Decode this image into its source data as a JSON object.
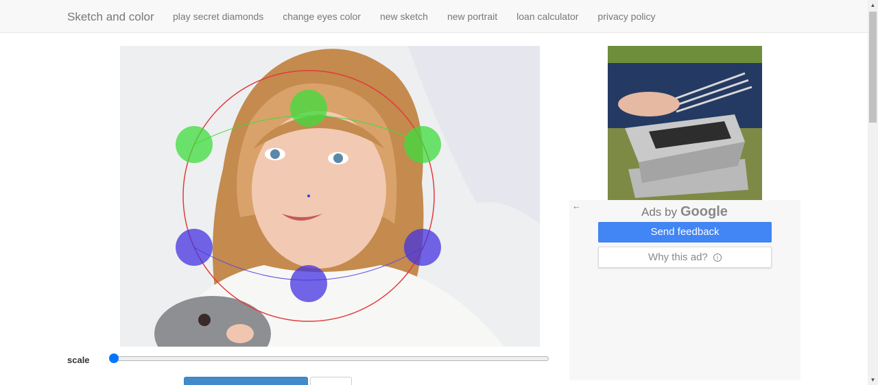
{
  "navbar": {
    "brand": "Sketch and color",
    "links": [
      "play secret diamonds",
      "change eyes color",
      "new sketch",
      "new portrait",
      "loan calculator",
      "privacy policy"
    ]
  },
  "photo": {
    "subject": "girl-with-rabbit-photo",
    "overlay_colors": {
      "guide_circle": "#e23a3a",
      "upper_handles": "#3edc3e",
      "lower_handles": "#4433e0",
      "center_point": "#3344dd"
    }
  },
  "controls": {
    "scale_label": "scale",
    "scale_value": 0
  },
  "buttons": {
    "primary_label": "",
    "secondary_label": ""
  },
  "ad": {
    "back_icon": "←",
    "ads_by": "Ads by",
    "ads_brand": "Google",
    "send_feedback": "Send feedback",
    "why_this_ad": "Why this ad?",
    "info_icon": "ⓘ"
  },
  "scrollbar": {
    "up_arrow": "▲",
    "down_arrow": "▼"
  }
}
